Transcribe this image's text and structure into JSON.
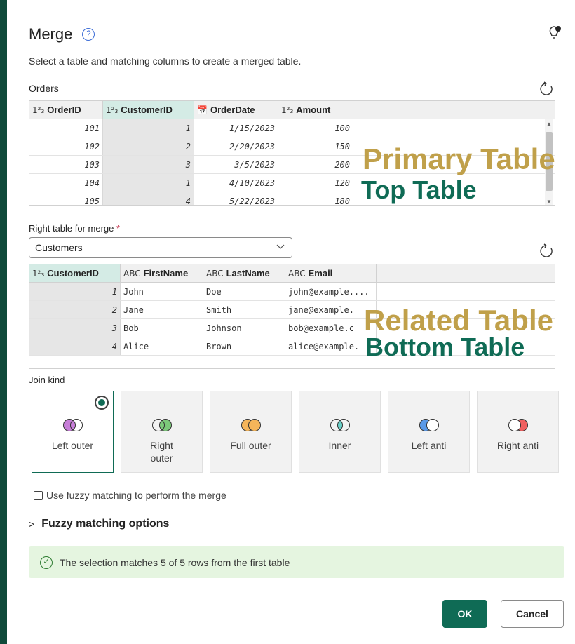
{
  "dialog": {
    "title": "Merge",
    "subtitle": "Select a table and matching columns to create a merged table."
  },
  "top_table": {
    "name": "Orders",
    "columns": [
      {
        "type": "1²₃",
        "label": "OrderID"
      },
      {
        "type": "1²₃",
        "label": "CustomerID"
      },
      {
        "type": "📅",
        "label": "OrderDate"
      },
      {
        "type": "1²₃",
        "label": "Amount"
      }
    ],
    "rows": [
      [
        "101",
        "1",
        "1/15/2023",
        "100"
      ],
      [
        "102",
        "2",
        "2/20/2023",
        "150"
      ],
      [
        "103",
        "3",
        "3/5/2023",
        "200"
      ],
      [
        "104",
        "1",
        "4/10/2023",
        "120"
      ],
      [
        "105",
        "4",
        "5/22/2023",
        "180"
      ]
    ]
  },
  "right_table": {
    "label": "Right table for merge",
    "required_mark": "*",
    "selected": "Customers",
    "columns": [
      {
        "type": "1²₃",
        "label": "CustomerID"
      },
      {
        "type": "ABC",
        "label": "FirstName"
      },
      {
        "type": "ABC",
        "label": "LastName"
      },
      {
        "type": "ABC",
        "label": "Email"
      }
    ],
    "rows": [
      [
        "1",
        "John",
        "Doe",
        "john@example...."
      ],
      [
        "2",
        "Jane",
        "Smith",
        "jane@example."
      ],
      [
        "3",
        "Bob",
        "Johnson",
        "bob@example.c"
      ],
      [
        "4",
        "Alice",
        "Brown",
        "alice@example."
      ]
    ]
  },
  "overlays": {
    "primary": "Primary Table",
    "top": "Top Table",
    "related": "Related Table",
    "bottom": "Bottom Table"
  },
  "join": {
    "label": "Join kind",
    "options": [
      {
        "label": "Left outer",
        "selected": true,
        "colors": [
          "#c77ed8",
          "#ffffff"
        ]
      },
      {
        "label": "Right outer",
        "selected": false,
        "colors": [
          "#ffffff",
          "#7cc87a"
        ]
      },
      {
        "label": "Full outer",
        "selected": false,
        "colors": [
          "#f5b55a",
          "#f5b55a"
        ]
      },
      {
        "label": "Inner",
        "selected": false,
        "colors": [
          "#ffffff",
          "#ffffff"
        ]
      },
      {
        "label": "Left anti",
        "selected": false,
        "colors": [
          "#5b9ae8",
          "#ffffff"
        ]
      },
      {
        "label": "Right anti",
        "selected": false,
        "colors": [
          "#ffffff",
          "#f06060"
        ]
      }
    ]
  },
  "fuzzy": {
    "checkbox_label": "Use fuzzy matching to perform the merge",
    "options_label": "Fuzzy matching options"
  },
  "status": {
    "text": "The selection matches 5 of 5 rows from the first table"
  },
  "buttons": {
    "ok": "OK",
    "cancel": "Cancel"
  },
  "colors": {
    "accent": "#0f6b55",
    "overlay_gold": "#c0a04a"
  }
}
